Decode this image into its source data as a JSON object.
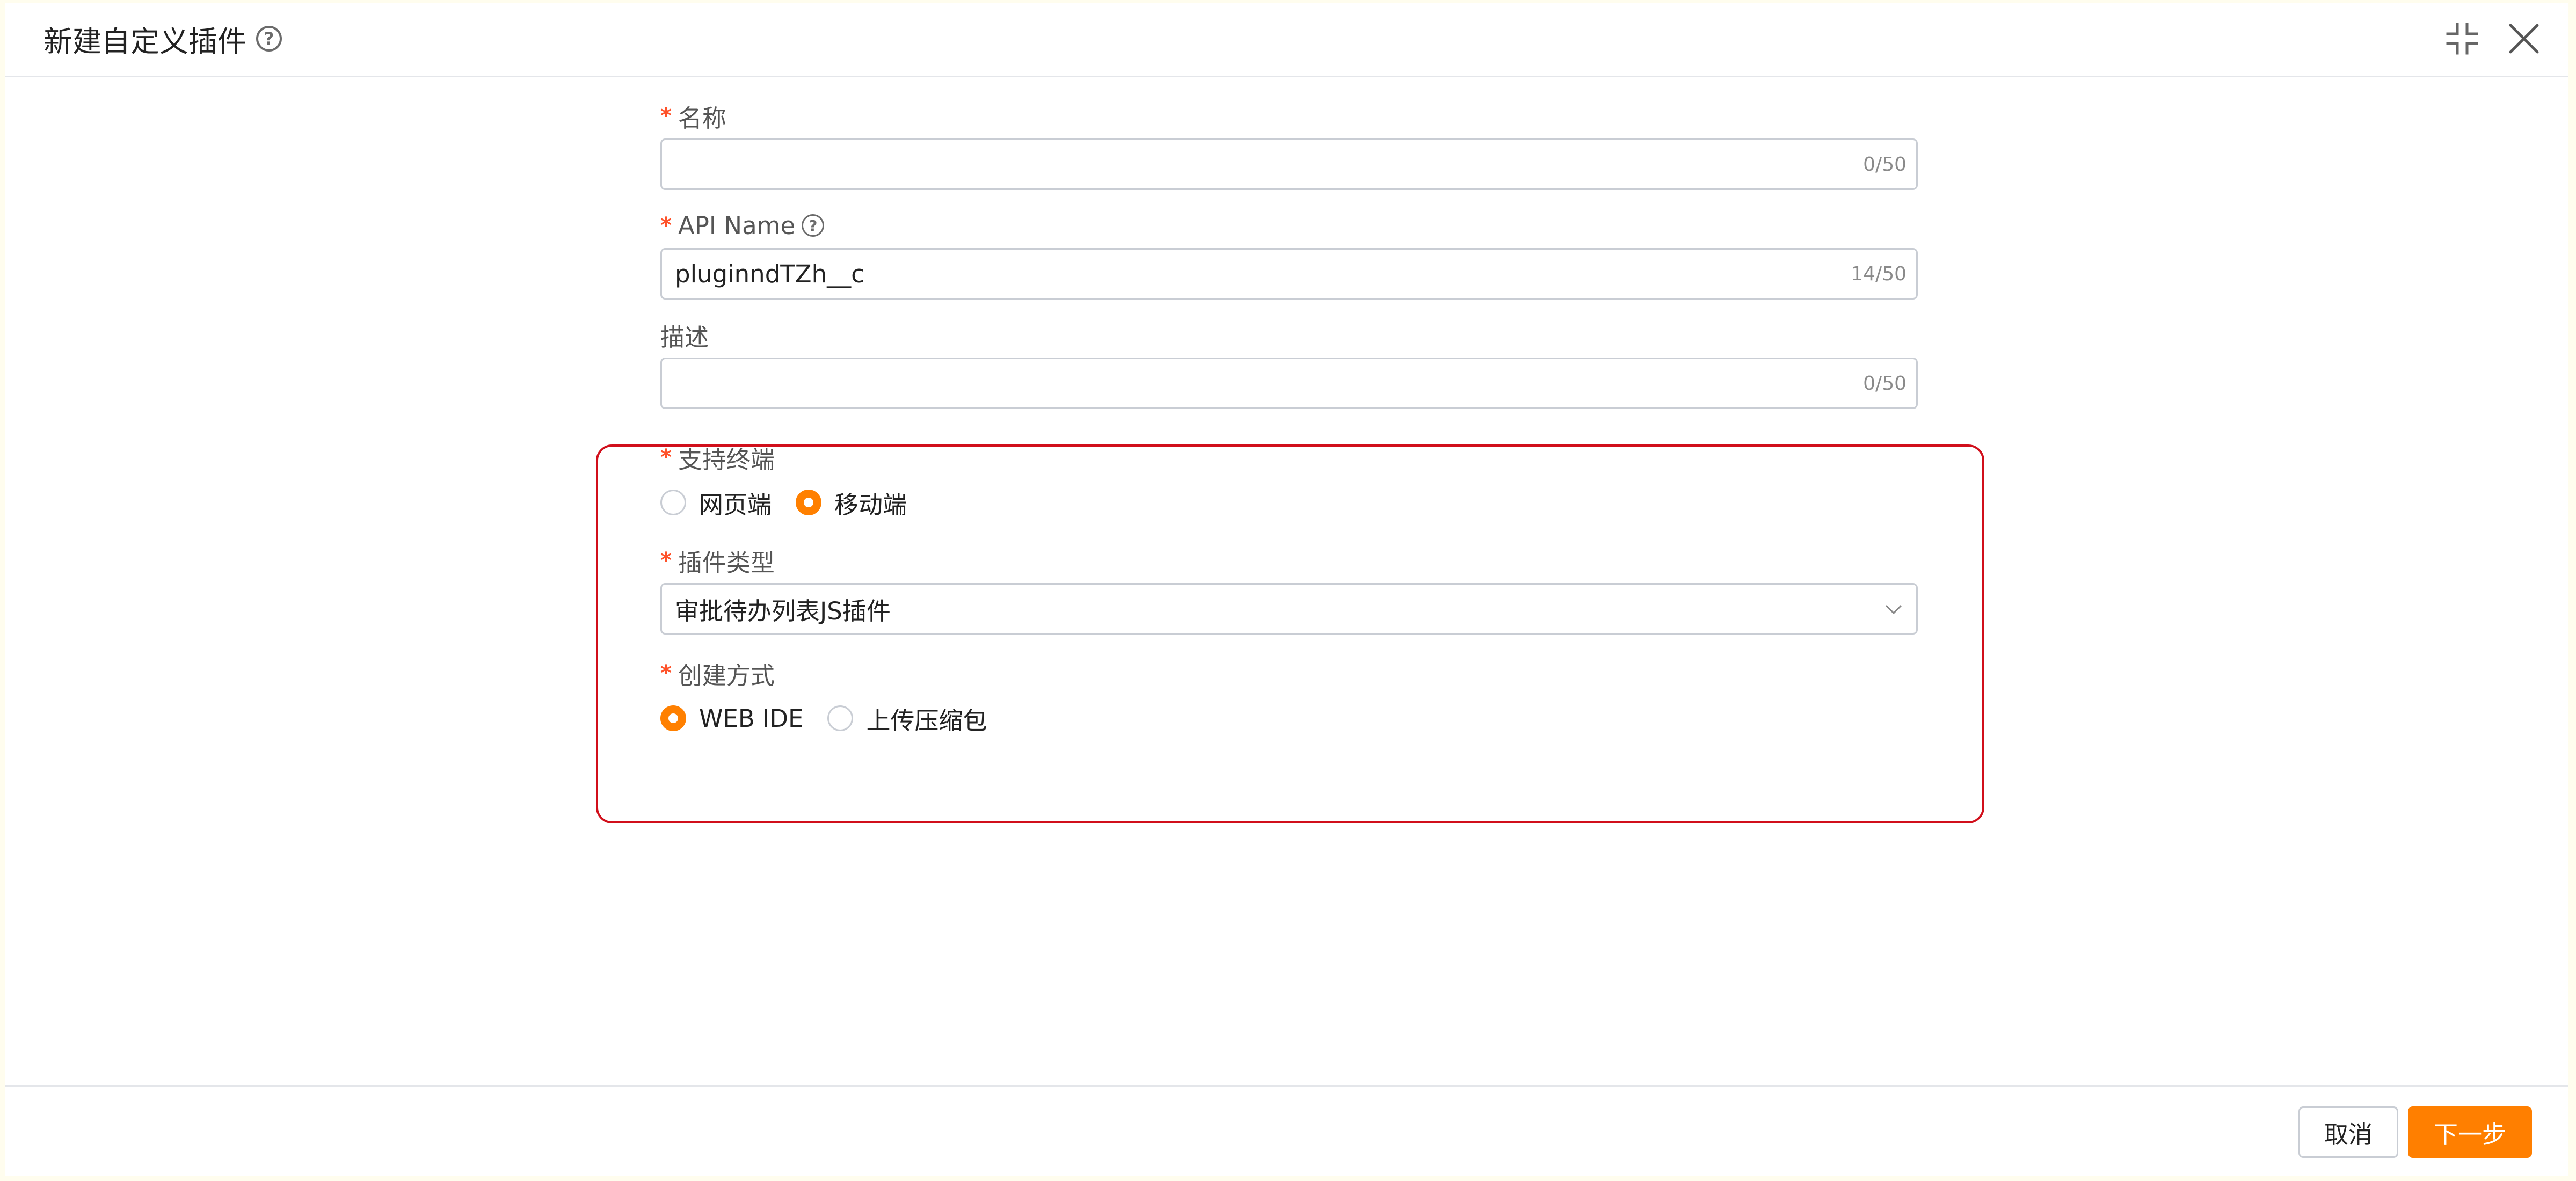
{
  "dialog": {
    "title": "新建自定义插件"
  },
  "form": {
    "name": {
      "label": "名称",
      "value": "",
      "counter": "0/50"
    },
    "api_name": {
      "label": "API Name",
      "value": "pluginndTZh__c",
      "counter": "14/50"
    },
    "description": {
      "label": "描述",
      "value": "",
      "counter": "0/50"
    },
    "terminal": {
      "label": "支持终端",
      "options": [
        {
          "label": "网页端",
          "checked": false
        },
        {
          "label": "移动端",
          "checked": true
        }
      ]
    },
    "plugin_type": {
      "label": "插件类型",
      "value": "审批待办列表JS插件"
    },
    "create_method": {
      "label": "创建方式",
      "options": [
        {
          "label": "WEB IDE",
          "checked": true
        },
        {
          "label": "上传压缩包",
          "checked": false
        }
      ]
    }
  },
  "footer": {
    "cancel_label": "取消",
    "next_label": "下一步"
  },
  "colors": {
    "accent": "#ff7f00",
    "required": "#ff522a",
    "highlight_border": "#d10f1b",
    "input_border": "#c9cdd4"
  },
  "icons": {
    "help": "help-circle-icon",
    "collapse": "collapse-icon",
    "close": "close-icon",
    "chevron": "chevron-down-icon"
  }
}
